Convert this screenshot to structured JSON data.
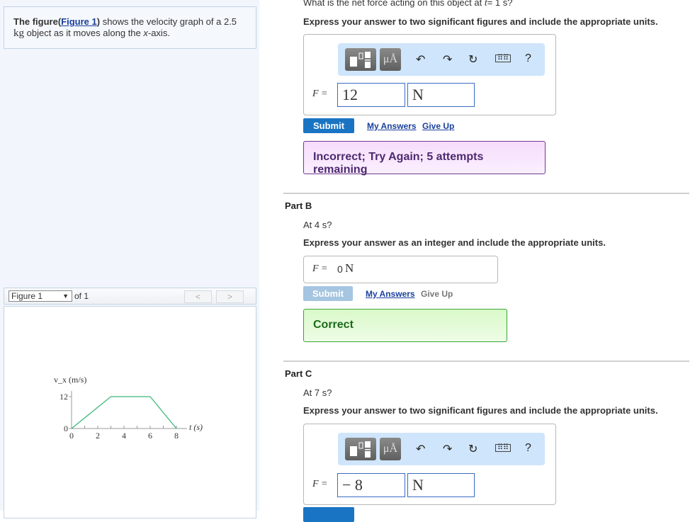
{
  "problem": {
    "bold_lead": "The figure(",
    "figure_link": "Figure 1",
    "bold_close": ")",
    "text_after": " shows the velocity graph of a 2.5",
    "unit": "kg",
    "text_end_a": " object as it moves along the ",
    "axis_var": "x",
    "text_end_b": "-axis."
  },
  "figure_nav": {
    "selected": "Figure 1",
    "of_label": "of 1",
    "prev": "<",
    "next": ">"
  },
  "chart_data": {
    "type": "line",
    "xlabel": "t (s)",
    "ylabel": "v_x (m/s)",
    "xticks": [
      0,
      2,
      4,
      6,
      8
    ],
    "yticks": [
      0,
      12
    ],
    "xlim": [
      0,
      8
    ],
    "ylim": [
      0,
      12
    ],
    "grid": false,
    "series": [
      {
        "x": [
          0,
          3,
          6,
          8
        ],
        "y": [
          0,
          12,
          12,
          0
        ],
        "color": "#3cb878"
      }
    ]
  },
  "partA": {
    "question_a": "What is the net force acting on this object at ",
    "question_var": "t",
    "question_b": "= 1 s?",
    "instruction": "Express your answer to two significant figures and include the appropriate units.",
    "toolbar": {
      "templates": "templates-icon",
      "units": "μÅ",
      "undo": "undo-icon",
      "redo": "redo-icon",
      "reset": "reset-icon",
      "keyboard": "keyboard-icon",
      "help": "?"
    },
    "label": "F =",
    "value": "12",
    "units": "N",
    "submit": "Submit",
    "my_answers": "My Answers",
    "give_up": "Give Up",
    "feedback": "Incorrect; Try Again; 5 attempts remaining"
  },
  "partB": {
    "title": "Part B",
    "question": "At 4 s?",
    "instruction": "Express your answer as an integer and include the appropriate units.",
    "label": "F =",
    "answer_value": "0",
    "answer_units": "N",
    "submit": "Submit",
    "my_answers": "My Answers",
    "give_up": "Give Up",
    "feedback": "Correct"
  },
  "partC": {
    "title": "Part C",
    "question": "At 7 s?",
    "instruction": "Express your answer to two significant figures and include the appropriate units.",
    "toolbar": {
      "units": "μÅ",
      "help": "?"
    },
    "label": "F =",
    "value": "− 8",
    "units": "N"
  },
  "colors": {
    "submit": "#1a74c4",
    "submit_disabled": "#a5c5e0",
    "incorrect_bg": "#f9e6fd",
    "correct_bg": "#e2f9d3",
    "graph_line": "#3cb878"
  }
}
